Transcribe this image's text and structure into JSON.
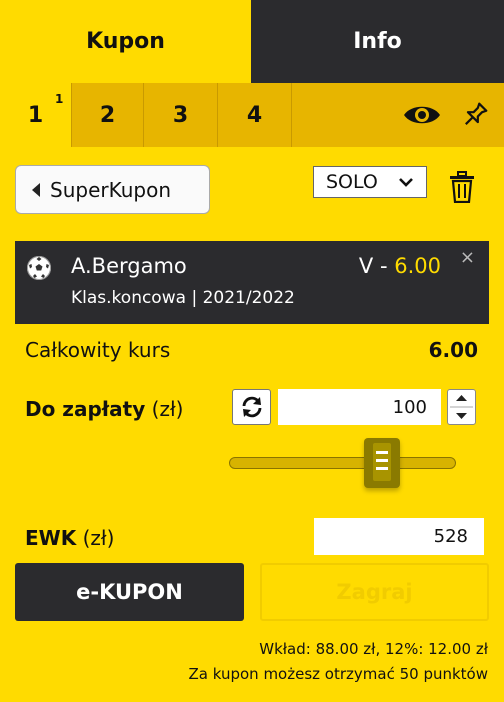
{
  "tabs": {
    "kupon": "Kupon",
    "info": "Info"
  },
  "coupon_tabs": {
    "items": [
      "1",
      "2",
      "3",
      "4"
    ],
    "active_badge": "1",
    "icons": [
      "eye-icon",
      "pin-icon"
    ]
  },
  "superkupon_label": "SuperKupon",
  "bet_type": {
    "selected": "SOLO"
  },
  "bet": {
    "team": "A.Bergamo",
    "outcome": "V",
    "separator": "-",
    "odds": "6.00",
    "close": "×",
    "market": "Klas.koncowa",
    "divider": "|",
    "season": "2021/2022"
  },
  "total_odds": {
    "label": "Całkowity kurs",
    "value": "6.00"
  },
  "stake": {
    "label": "Do zapłaty",
    "unit": "(zł)",
    "value": "100"
  },
  "stake_slider": {
    "level": 0.6
  },
  "ewk": {
    "label": "EWK",
    "unit": "(zł)",
    "value": "528"
  },
  "buttons": {
    "ekupon": "e-KUPON",
    "zagraj": "Zagraj"
  },
  "footer": {
    "line1": "Wkład: 88.00 zł, 12%: 12.00 zł",
    "line2": "Za kupon możesz otrzymać 50 punktów"
  },
  "colors": {
    "brand_yellow": "#ffdb00",
    "dark": "#2b2b2e",
    "tab_yellow": "#e7b500"
  }
}
